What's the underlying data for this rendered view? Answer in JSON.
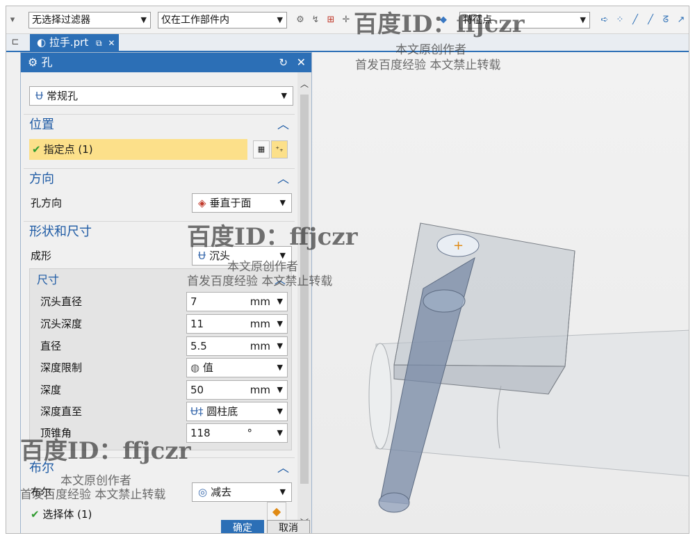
{
  "toolbar": {
    "filter": "无选择过滤器",
    "scope": "仅在工作部件内",
    "snap": "特征点"
  },
  "tab": {
    "label": "拉手.prt"
  },
  "dialog": {
    "title": "孔",
    "hole_type": "常规孔",
    "sections": {
      "position": "位置",
      "direction": "方向",
      "shape": "形状和尺寸",
      "dimensions": "尺寸",
      "layout": "布尔"
    },
    "specify_point": "指定点 (1)",
    "hole_direction_label": "孔方向",
    "hole_direction_value": "垂直于面",
    "form_label": "成形",
    "form_value": "沉头",
    "dims": [
      {
        "label": "沉头直径",
        "value": "7",
        "unit": "mm"
      },
      {
        "label": "沉头深度",
        "value": "11",
        "unit": "mm"
      },
      {
        "label": "直径",
        "value": "5.5",
        "unit": "mm"
      },
      {
        "label": "深度限制",
        "value": "值",
        "unit": ""
      },
      {
        "label": "深度",
        "value": "50",
        "unit": "mm"
      },
      {
        "label": "深度直至",
        "value": "圆柱底",
        "unit": ""
      },
      {
        "label": "顶锥角",
        "value": "118",
        "unit": "°"
      }
    ],
    "boolean_label": "布尔",
    "boolean_value": "减去",
    "select_body": "选择体 (1)",
    "ok": "确定",
    "cancel": "取消"
  },
  "watermark": {
    "id": "百度ID：ffjczr",
    "line1": "本文原创作者",
    "line2": "首发百度经验   本文禁止转载"
  },
  "colors": {
    "accent": "#2c6fb6",
    "highlight": "#fce08a",
    "section": "#1d5aa4"
  }
}
